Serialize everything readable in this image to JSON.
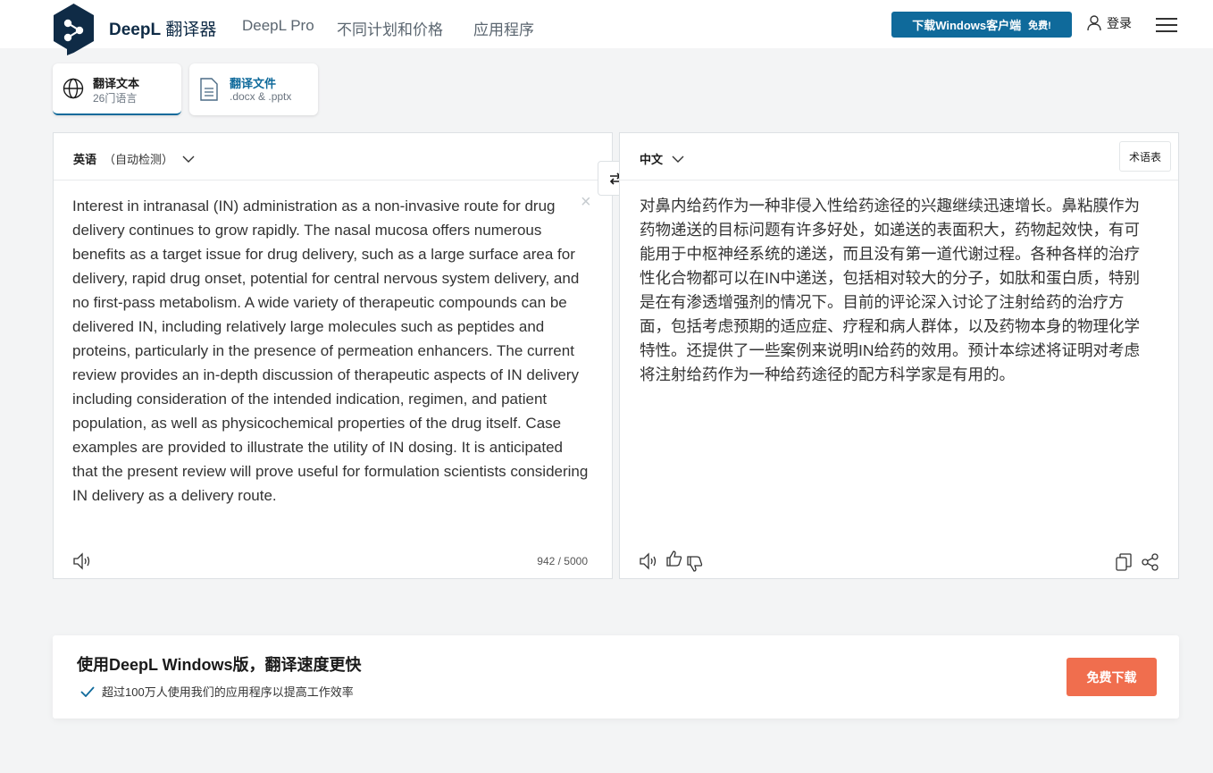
{
  "header": {
    "brand_name": "DeepL",
    "brand_suffix": "翻译器",
    "nav": [
      "DeepL Pro",
      "不同计划和价格",
      "应用程序"
    ],
    "download_button": "下载Windows客户端",
    "download_free": "免费!",
    "login": "登录"
  },
  "tabs": [
    {
      "title": "翻译文本",
      "subtitle": "26门语言",
      "icon": "globe-icon"
    },
    {
      "title": "翻译文件",
      "subtitle": ".docx & .pptx",
      "icon": "document-icon"
    }
  ],
  "source": {
    "language": "英语",
    "auto_detect": "（自动检测）",
    "text": "Interest in intranasal (IN) administration as a non-invasive route for drug delivery continues to grow rapidly. The nasal mucosa offers numerous benefits as a target issue for drug delivery, such as a large surface area for delivery, rapid drug onset, potential for central nervous system delivery, and no first-pass metabolism. A wide variety of therapeutic compounds can be delivered IN, including relatively large molecules such as peptides and proteins, particularly in the presence of permeation enhancers. The current review provides an in-depth discussion of therapeutic aspects of IN delivery including consideration of the intended indication, regimen, and patient population, as well as physicochemical properties of the drug itself. Case examples are provided to illustrate the utility of IN dosing. It is anticipated that the present review will prove useful for formulation scientists considering IN delivery as a delivery route.",
    "char_count": "942 / 5000"
  },
  "target": {
    "language": "中文",
    "glossary": "术语表",
    "text": "对鼻内给药作为一种非侵入性给药途径的兴趣继续迅速增长。鼻粘膜作为药物递送的目标问题有许多好处，如递送的表面积大，药物起效快，有可能用于中枢神经系统的递送，而且没有第一道代谢过程。各种各样的治疗性化合物都可以在IN中递送，包括相对较大的分子，如肽和蛋白质，特别是在有渗透增强剂的情况下。目前的评论深入讨论了注射给药的治疗方面，包括考虑预期的适应症、疗程和病人群体，以及药物本身的物理化学特性。还提供了一些案例来说明IN给药的效用。预计本综述将证明对考虑将注射给药作为一种给药途径的配方科学家是有用的。"
  },
  "promo": {
    "title": "使用DeepL Windows版，翻译速度更快",
    "subtitle": "超过100万人使用我们的应用程序以提高工作效率",
    "button": "免费下载"
  },
  "colors": {
    "brand": "#0f2b46",
    "primary": "#0f6a9b",
    "cta": "#f06e4e"
  }
}
